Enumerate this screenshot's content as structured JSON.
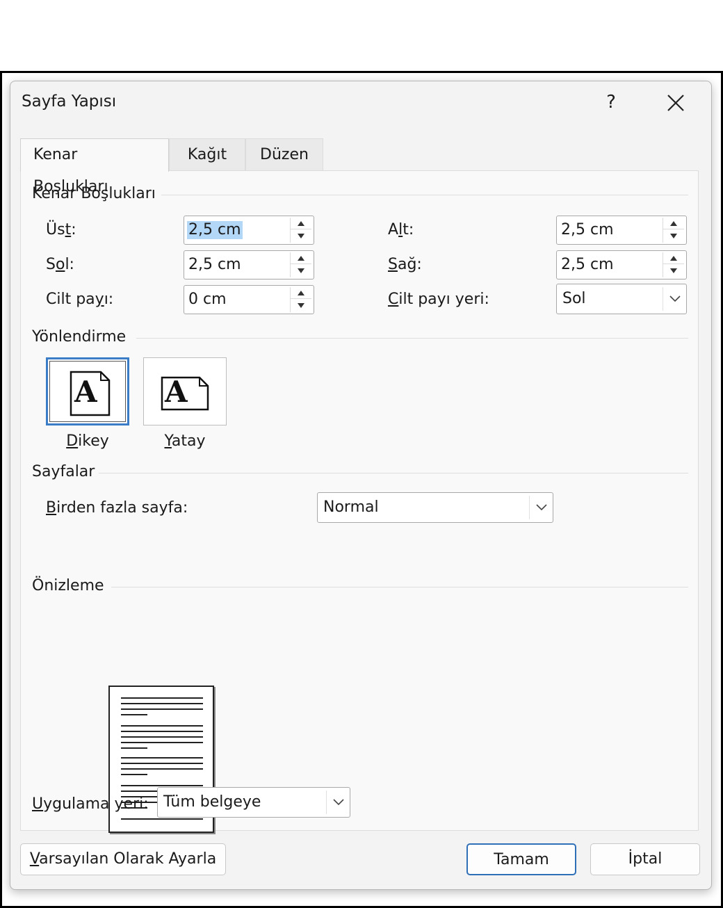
{
  "dialog": {
    "title": "Sayfa Yapısı",
    "help_label": "?"
  },
  "tabs": [
    {
      "label": "Kenar Boşlukları",
      "active": true
    },
    {
      "label": "Kağıt",
      "active": false
    },
    {
      "label": "Düzen",
      "active": false
    }
  ],
  "margins": {
    "group_title": "Kenar Boşlukları",
    "top": {
      "label_pre": "Üs",
      "label_u": "t",
      "label_post": ":",
      "value": "2,5 cm"
    },
    "bottom": {
      "label_pre": "A",
      "label_u": "l",
      "label_post": "t:",
      "value": "2,5 cm"
    },
    "left": {
      "label_pre": "S",
      "label_u": "o",
      "label_post": "l:",
      "value": "2,5 cm"
    },
    "right": {
      "label_pre": "",
      "label_u": "S",
      "label_post": "ağ:",
      "value": "2,5 cm"
    },
    "gutter": {
      "label_pre": "Cilt pa",
      "label_u": "y",
      "label_post": "ı:",
      "value": "0 cm"
    },
    "gutter_pos": {
      "label_pre": "",
      "label_u": "C",
      "label_post": "ilt payı yeri:",
      "value": "Sol"
    }
  },
  "orientation": {
    "group_title": "Yönlendirme",
    "portrait": {
      "label_u": "D",
      "label_post": "ikey",
      "selected": true
    },
    "landscape": {
      "label_u": "Y",
      "label_post": "atay",
      "selected": false
    }
  },
  "pages": {
    "group_title": "Sayfalar",
    "multiple": {
      "label_u": "B",
      "label_post": "irden fazla sayfa:",
      "value": "Normal"
    }
  },
  "preview": {
    "group_title": "Önizleme"
  },
  "apply": {
    "label_u": "U",
    "label_post": "ygulama yeri:",
    "value": "Tüm belgeye"
  },
  "buttons": {
    "default_u": "V",
    "default_post": "arsayılan Olarak Ayarla",
    "ok": "Tamam",
    "cancel": "İptal"
  },
  "icons": {
    "orientation_glyph": "A"
  }
}
